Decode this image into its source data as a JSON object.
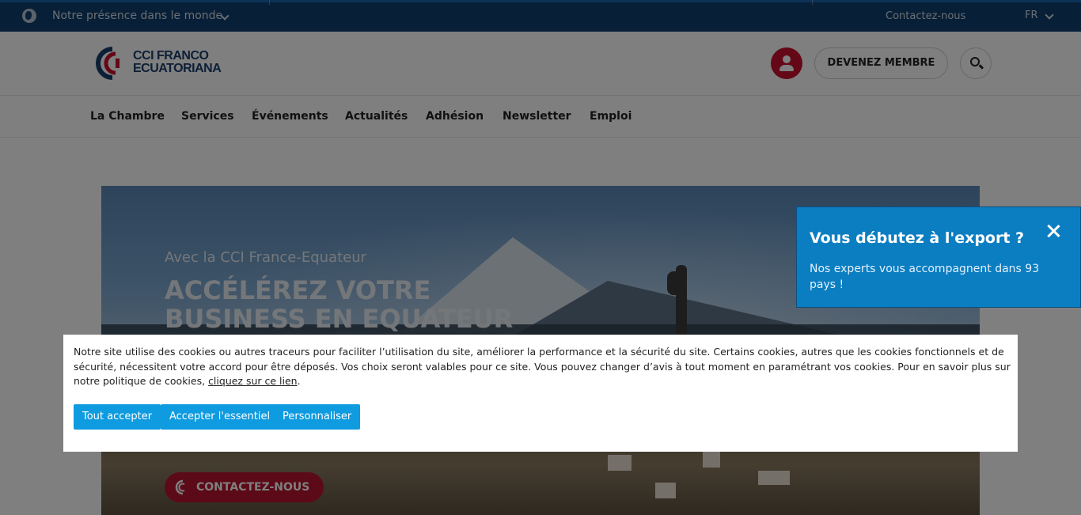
{
  "topbar": {
    "presence_label": "Notre présence dans le monde",
    "contact_label": "Contactez-nous",
    "language": "FR"
  },
  "header": {
    "logo_line1": "CCI FRANCO",
    "logo_line2": "ECUATORIANA",
    "member_button": "DEVENEZ MEMBRE"
  },
  "nav": {
    "items": [
      "La Chambre",
      "Services",
      "Événements",
      "Actualités",
      "Adhésion",
      "Newsletter",
      "Emploi"
    ]
  },
  "hero": {
    "subtitle": "Avec la CCI France-Equateur",
    "title_line1": "ACCÉLÉREZ VOTRE",
    "title_line2": "BUSINESS EN EQUATEUR",
    "cta_label": "CONTACTEZ-NOUS"
  },
  "export_popup": {
    "title": "Vous débutez à l'export ?",
    "text": "Nos experts vous accompagnent dans 93 pays !"
  },
  "cookie_banner": {
    "text_before_link": "Notre site utilise des cookies ou autres traceurs pour faciliter l’utilisation du site, améliorer la performance et la sécurité du site. Certains cookies, autres que les cookies fonctionnels et de sécurité, nécessitent votre accord pour être déposés. Vos choix seront valables pour ce site. Vous pouvez changer d’avis à tout moment en paramétrant vos cookies. Pour en savoir plus sur notre politique de cookies, ",
    "link_text": "cliquez sur ce lien",
    "text_after_link": ".",
    "accept_all": "Tout accepter",
    "accept_essential": "Accepter l'essentiel",
    "customize": "Personnaliser"
  },
  "colors": {
    "topbar": "#0e3f6e",
    "brand_red": "#c8102e",
    "brand_blue": "#1b3f6d",
    "popup_blue": "#0b7ec2",
    "cookie_button": "#0e9be0"
  },
  "icons": {
    "globe": "globe-icon",
    "chevron": "chevron-down-icon",
    "user": "user-icon",
    "search": "search-icon",
    "close": "close-icon"
  }
}
